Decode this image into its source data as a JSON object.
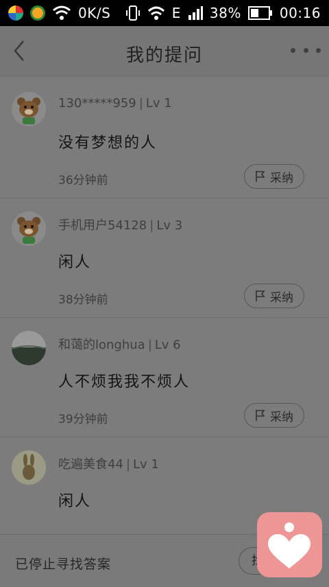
{
  "status": {
    "network_speed": "0K/S",
    "signal_label": "E",
    "battery": "38%",
    "time": "00:16"
  },
  "header": {
    "title": "我的提问"
  },
  "questions": [
    {
      "user": "130*****959",
      "level": "Lv 1",
      "text": "没有梦想的人",
      "time": "36分钟前",
      "adopt_label": "采纳"
    },
    {
      "user": "手机用户54128",
      "level": "Lv 3",
      "text": "闲人",
      "time": "38分钟前",
      "adopt_label": "采纳"
    },
    {
      "user": "和蔼的longhua",
      "level": "Lv 6",
      "text": "人不烦我我不烦人",
      "time": "39分钟前",
      "adopt_label": "采纳"
    },
    {
      "user": "吃遍美食44",
      "level": "Lv 1",
      "text": "闲人"
    }
  ],
  "footer": {
    "status_text": "已停止寻找答案",
    "button_label": "找"
  },
  "colors": {
    "float_button": "#ee9696",
    "statusbar": "#000000"
  }
}
